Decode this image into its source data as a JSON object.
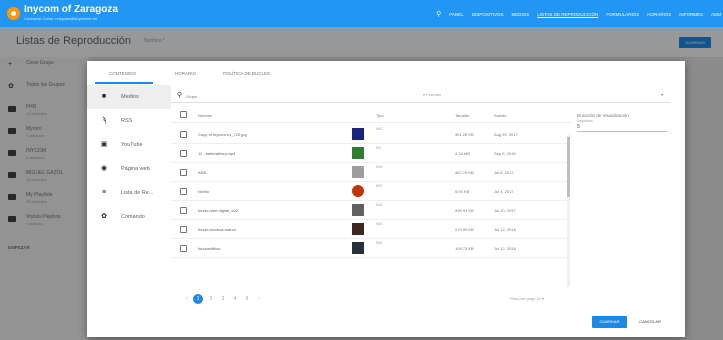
{
  "app": {
    "title": "Inycom of Zaragoza",
    "subtitle": "Contactar Como: reliquias@anywhere.es"
  },
  "topnav": {
    "search_icon": "search-icon",
    "items": [
      "PANEL",
      "DISPOSITIVOS",
      "MEDIOS",
      "LISTAS DE REPRODUCCIÓN",
      "FORMULARIOS",
      "HORARIOS",
      "INFORMES",
      "ADM"
    ],
    "active_index": 3
  },
  "page": {
    "title": "Listas de Reproducción",
    "name_placeholder": "Nombre *",
    "save_label": "GUARDAR"
  },
  "sidebar": {
    "items": [
      {
        "icon": "plus-icon",
        "label": "Crear Grupo",
        "sub": ""
      },
      {
        "icon": "gear-icon",
        "label": "Todos los Grupos",
        "sub": ""
      },
      {
        "icon": "folder-icon",
        "label": "FHR",
        "sub": "15 artículos"
      },
      {
        "icon": "folder-icon",
        "label": "Myrom",
        "sub": "3 artículos"
      },
      {
        "icon": "folder-icon",
        "label": "INYCOM",
        "sub": "5 artículos"
      },
      {
        "icon": "folder-icon",
        "label": "MIGUEL GAZOL",
        "sub": "15 artículos"
      },
      {
        "icon": "folder-icon",
        "label": "My Playlists",
        "sub": "35 artículos"
      },
      {
        "icon": "folder-icon",
        "label": "Vistula Playlists",
        "sub": "1 artículo"
      }
    ],
    "empezar_label": "EMPEZAR"
  },
  "modal": {
    "tabs": [
      "CONTENIDO",
      "HORARIO",
      "POLÍTICA DE BUCLES"
    ],
    "active_tab": 0,
    "nav": [
      {
        "icon": "folder-icon",
        "label": "Medios"
      },
      {
        "icon": "rss-icon",
        "label": "RSS"
      },
      {
        "icon": "youtube-icon",
        "label": "YouTube"
      },
      {
        "icon": "globe-icon",
        "label": "Página web"
      },
      {
        "icon": "playlist-icon",
        "label": "Lista de Re..."
      },
      {
        "icon": "gear-icon",
        "label": "Comando"
      }
    ],
    "search_placeholder": "Grupo",
    "filter_label": "▾ Formato",
    "columns": {
      "name": "Nombre",
      "type": "Tipo",
      "size": "Tamaño",
      "uploaded": "Subido"
    },
    "rows": [
      {
        "name": "Copy of Inycom.n1_720.jpg",
        "type": "IMG",
        "size": "301.26 KB",
        "date": "Aug 29, 2017",
        "thumb": "#1a237e"
      },
      {
        "name": "11 - betterabbey.mp4",
        "type": "MV",
        "size": "4.24 MB",
        "date": "Sep 9, 2016",
        "thumb": "#2e7d32"
      },
      {
        "name": "ADN",
        "type": "IMG",
        "size": "457.76 KB",
        "date": "Jul 8, 2017",
        "thumb": "#9e9e9e"
      },
      {
        "name": "Nivirlo",
        "type": "IMG",
        "size": "5.93 KB",
        "date": "Jul 4, 2017",
        "thumb": "#bf360c"
      },
      {
        "name": "fondo-nivel digital_v02",
        "type": "IMG",
        "size": "995.93 KB",
        "date": "Jul 20, 2017",
        "thumb": "#616161"
      },
      {
        "name": "fondo-cerveza-marco",
        "type": "IMG",
        "size": "215.99 KB",
        "date": "Jul 12, 2016",
        "thumb": "#3e2723"
      },
      {
        "name": "fondoedificio",
        "type": "IMG",
        "size": "109.73 KB",
        "date": "Jul 12, 2016",
        "thumb": "#263238"
      }
    ],
    "pages": [
      "‹",
      "1",
      "2",
      "3",
      "4",
      "5",
      "›"
    ],
    "active_page": 1,
    "rows_per_page": "Filas por page 10 ▾",
    "duration": {
      "label": "Duración de Visualización",
      "sub": "Segundos",
      "value": "5"
    },
    "save_label": "GUARDAR",
    "cancel_label": "CANCELAR"
  },
  "colors": {
    "accent": "#2196f3",
    "button": "#1e88e5",
    "logo": "#ff9800"
  }
}
